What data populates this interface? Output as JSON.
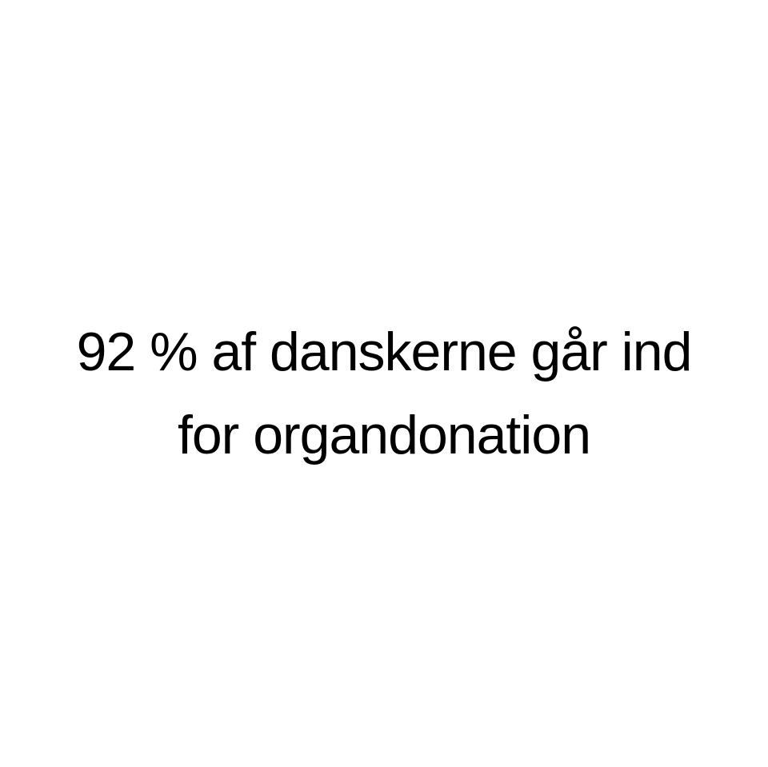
{
  "headline": {
    "line1": "92 % af danskerne går ind",
    "line2": "for organdonation"
  },
  "colors": {
    "background": "#ffffff",
    "text": "#000000"
  }
}
